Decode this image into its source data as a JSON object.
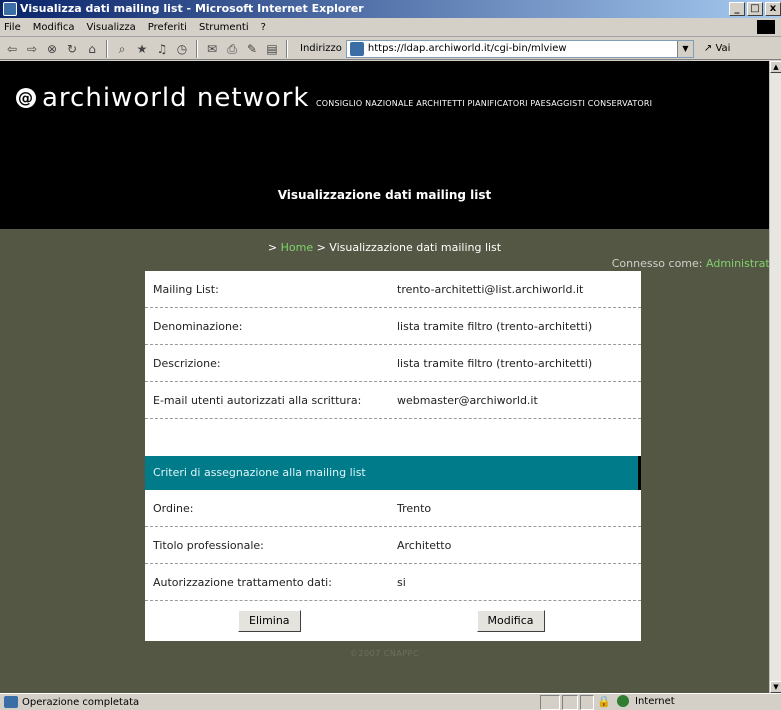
{
  "window": {
    "title": "Visualizza dati mailing list - Microsoft Internet Explorer"
  },
  "menu": [
    "File",
    "Modifica",
    "Visualizza",
    "Preferiti",
    "Strumenti",
    "?"
  ],
  "toolbar": {
    "address_label": "Indirizzo",
    "url": "https://ldap.archiworld.it/cgi-bin/mlview",
    "go_label": "Vai"
  },
  "header": {
    "logo_text": "archiworld network",
    "subtitle": "CONSIGLIO NAZIONALE ARCHITETTI PIANIFICATORI PAESAGGISTI CONSERVATORI",
    "page_heading": "Visualizzazione dati mailing list"
  },
  "breadcrumb": {
    "sep1": "> ",
    "home": "Home",
    "rest": " > Visualizzazione dati mailing list"
  },
  "session": {
    "label": "Connesso come: ",
    "user": "Administrator"
  },
  "details": [
    {
      "label": "Mailing List:",
      "value": "trento-architetti@list.archiworld.it"
    },
    {
      "label": "Denominazione:",
      "value": "lista tramite filtro (trento-architetti)"
    },
    {
      "label": "Descrizione:",
      "value": "lista tramite filtro (trento-architetti)"
    },
    {
      "label": "E-mail utenti autorizzati alla scrittura:",
      "value": "webmaster@archiworld.it"
    }
  ],
  "criteria": {
    "heading": "Criteri di assegnazione alla mailing list",
    "rows": [
      {
        "label": "Ordine:",
        "value": "Trento"
      },
      {
        "label": "Titolo professionale:",
        "value": "Architetto"
      },
      {
        "label": "Autorizzazione trattamento dati:",
        "value": "si"
      }
    ]
  },
  "actions": {
    "delete_label": "Elimina",
    "edit_label": "Modifica"
  },
  "footer": {
    "copyright": "©2007 CNAPPC"
  },
  "status": {
    "text": "Operazione completata",
    "zone": "Internet"
  },
  "colors": {
    "page_bg": "#555745",
    "header_bg": "#000000",
    "section_head": "#007b8a",
    "link_green": "#7fd26c"
  }
}
